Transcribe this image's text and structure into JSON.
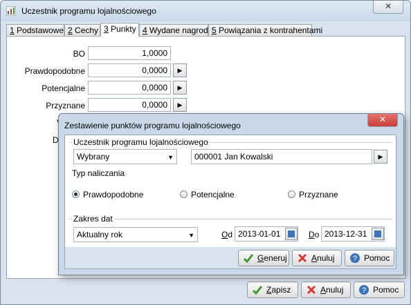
{
  "window": {
    "title": "Uczestnik programu lojalnościowego",
    "close": "✕"
  },
  "tabs": [
    {
      "key": "1",
      "label": " Podstawowe"
    },
    {
      "key": "2",
      "label": " Cechy"
    },
    {
      "key": "3",
      "label": " Punkty"
    },
    {
      "key": "4",
      "label": " Wydane nagrody"
    },
    {
      "key": "5",
      "label": " Powiązania z kontrahentami"
    }
  ],
  "points": {
    "bo_label": "BO",
    "bo_value": "1,0000",
    "probable_label": "Prawdopodobne",
    "probable_value": "0,0000",
    "potential_label": "Potencjalne",
    "potential_value": "0,0000",
    "granted_label": "Przyznane",
    "granted_value": "0,0000",
    "hidden_label_1": "V",
    "hidden_label_2": "D"
  },
  "footer": {
    "save_key": "Z",
    "save_rest": "apisz",
    "cancel_key": "A",
    "cancel_rest": "nuluj",
    "help": "Pomoc"
  },
  "dialog": {
    "title": "Zestawienie punktów programu lojalnościowego",
    "close": "✕",
    "participant_group": "Uczestnik programu lojalnościowego",
    "participant_mode": "Wybrany",
    "participant_value": "000001 Jan Kowalski",
    "calc_group": "Typ naliczania",
    "radio_probable": "Prawdopodobne",
    "radio_potential": "Potencjalne",
    "radio_granted": "Przyznane",
    "date_group": "Zakres dat",
    "date_range": "Aktualny rok",
    "from_key": "O",
    "from_rest": "d",
    "from_value": "2013-01-01",
    "to_key": "D",
    "to_rest": "o",
    "to_value": "2013-12-31",
    "generate_key": "G",
    "generate_rest": "eneruj",
    "cancel_key": "A",
    "cancel_rest": "nuluj",
    "help": "Pomoc"
  }
}
